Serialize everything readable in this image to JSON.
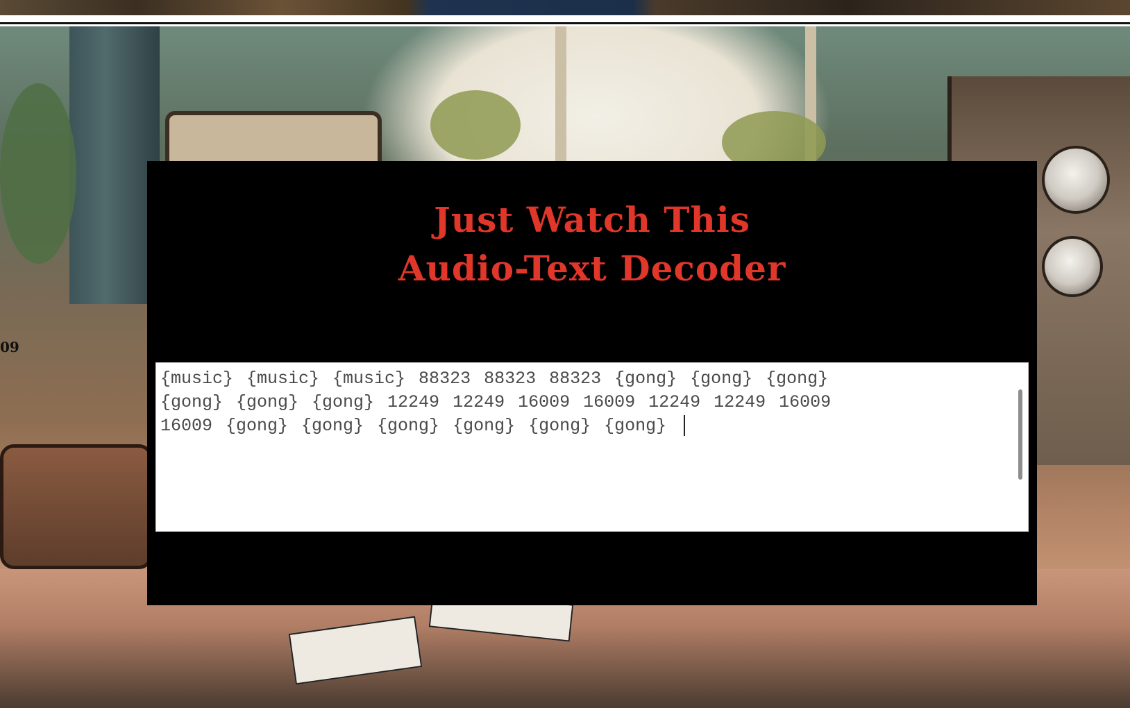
{
  "decoder": {
    "title_line1": "Just Watch This",
    "title_line2": "Audio-Text Decoder",
    "output_text": "{music} {music} {music} 88323 88323 88323 {gong} {gong} {gong}\n{gong} {gong} {gong} 12249 12249 16009 16009 12249 12249 16009\n16009 {gong} {gong} {gong} {gong} {gong} {gong} "
  },
  "background": {
    "left_edge_fragment": "09"
  },
  "colors": {
    "title": "#e0372a",
    "panel": "#000000",
    "output_background": "#ffffff"
  }
}
